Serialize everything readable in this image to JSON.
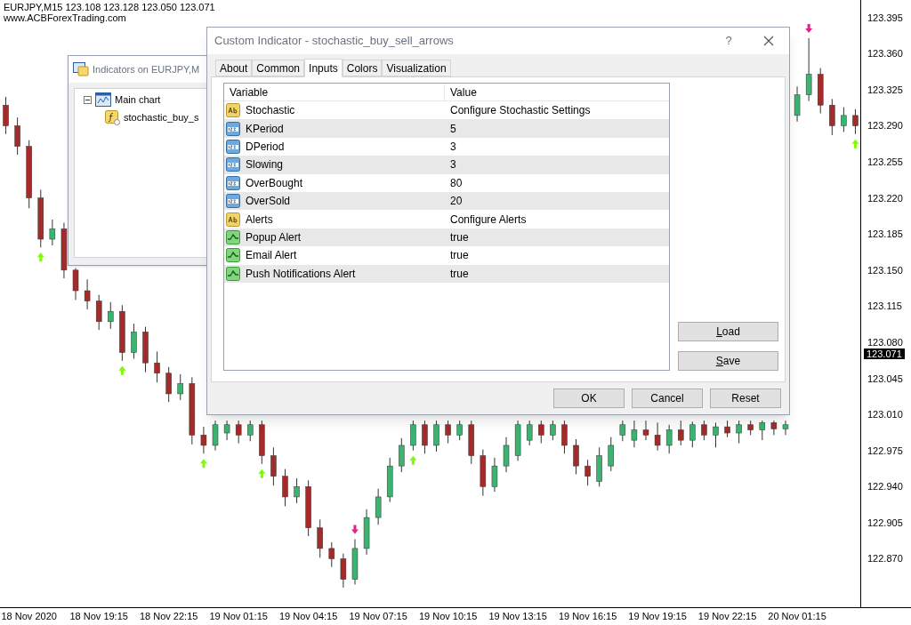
{
  "chart": {
    "symbol_info": "EURJPY,M15  123.108 123.128 123.050 123.071",
    "site": "www.ACBForexTrading.com",
    "current_price": "123.071",
    "chart_data": {
      "type": "candlestick",
      "categories": [
        null,
        null,
        "18 Nov 2020",
        null,
        null,
        null,
        null,
        null,
        "18 Nov 19:15",
        null,
        null,
        null,
        null,
        null,
        "18 Nov 22:15",
        null,
        null,
        null,
        null,
        null,
        "19 Nov 01:15",
        null,
        null,
        null,
        null,
        null,
        "19 Nov 04:15",
        null,
        null,
        null,
        null,
        null,
        "19 Nov 07:15",
        null,
        null,
        null,
        null,
        null,
        "19 Nov 10:15",
        null,
        null,
        null,
        null,
        null,
        "19 Nov 13:15",
        null,
        null,
        null,
        null,
        null,
        "19 Nov 16:15",
        null,
        null,
        null,
        null,
        null,
        "19 Nov 19:15",
        null,
        null,
        null,
        null,
        null,
        "19 Nov 22:15",
        null,
        null,
        null,
        null,
        null,
        "20 Nov 01:15",
        null,
        null,
        null,
        null,
        null
      ],
      "ohlc": [
        [
          123.31,
          123.318,
          123.282,
          123.29
        ],
        [
          123.29,
          123.298,
          123.262,
          123.27
        ],
        [
          123.27,
          123.276,
          123.21,
          123.22
        ],
        [
          123.22,
          123.228,
          123.172,
          123.18
        ],
        [
          123.18,
          123.199,
          123.174,
          123.19
        ],
        [
          123.19,
          123.196,
          123.142,
          123.15
        ],
        [
          123.15,
          123.152,
          123.121,
          123.13
        ],
        [
          123.13,
          123.141,
          123.112,
          123.12
        ],
        [
          123.12,
          123.126,
          123.092,
          123.1
        ],
        [
          123.1,
          123.119,
          123.093,
          123.11
        ],
        [
          123.11,
          123.116,
          123.062,
          123.07
        ],
        [
          123.07,
          123.098,
          123.064,
          123.09
        ],
        [
          123.09,
          123.095,
          123.051,
          123.06
        ],
        [
          123.06,
          123.071,
          123.041,
          123.05
        ],
        [
          123.05,
          123.056,
          123.022,
          123.03
        ],
        [
          123.03,
          123.049,
          123.024,
          123.04
        ],
        [
          123.04,
          123.046,
          122.981,
          122.99
        ],
        [
          122.99,
          122.998,
          122.972,
          122.98
        ],
        [
          122.98,
          123.004,
          122.975,
          123.0
        ],
        [
          122.992,
          123.004,
          122.985,
          123.0
        ],
        [
          123.0,
          123.004,
          122.982,
          122.99
        ],
        [
          122.99,
          123.004,
          122.984,
          123.0
        ],
        [
          123.0,
          123.004,
          122.962,
          122.97
        ],
        [
          122.97,
          122.978,
          122.941,
          122.95
        ],
        [
          122.95,
          122.957,
          122.921,
          122.93
        ],
        [
          122.93,
          122.948,
          122.924,
          122.94
        ],
        [
          122.94,
          122.946,
          122.892,
          122.9
        ],
        [
          122.9,
          122.908,
          122.871,
          122.88
        ],
        [
          122.88,
          122.886,
          122.862,
          122.87
        ],
        [
          122.87,
          122.875,
          122.842,
          122.85
        ],
        [
          122.85,
          122.889,
          122.845,
          122.88
        ],
        [
          122.88,
          122.918,
          122.874,
          122.91
        ],
        [
          122.91,
          122.938,
          122.903,
          122.93
        ],
        [
          122.93,
          122.968,
          122.925,
          122.96
        ],
        [
          122.96,
          122.987,
          122.954,
          122.98
        ],
        [
          122.98,
          123.004,
          122.975,
          123.0
        ],
        [
          123.0,
          123.004,
          122.972,
          122.98
        ],
        [
          122.98,
          123.004,
          122.974,
          123.0
        ],
        [
          123.0,
          123.004,
          122.982,
          122.99
        ],
        [
          122.99,
          123.004,
          122.985,
          123.0
        ],
        [
          123.0,
          123.004,
          122.962,
          122.97
        ],
        [
          122.97,
          122.976,
          122.931,
          122.94
        ],
        [
          122.94,
          122.968,
          122.935,
          122.96
        ],
        [
          122.96,
          122.988,
          122.954,
          122.98
        ],
        [
          122.97,
          123.004,
          122.965,
          123.0
        ],
        [
          122.985,
          123.004,
          122.98,
          123.0
        ],
        [
          123.0,
          123.004,
          122.982,
          122.99
        ],
        [
          122.99,
          123.004,
          122.985,
          123.0
        ],
        [
          123.0,
          123.004,
          122.972,
          122.98
        ],
        [
          122.98,
          122.986,
          122.952,
          122.96
        ],
        [
          122.96,
          122.966,
          122.941,
          122.95
        ],
        [
          122.945,
          122.978,
          122.94,
          122.97
        ],
        [
          122.96,
          122.988,
          122.955,
          122.98
        ],
        [
          122.99,
          123.004,
          122.984,
          123.0
        ],
        [
          122.985,
          123.004,
          122.978,
          122.995
        ],
        [
          122.995,
          123.004,
          122.985,
          122.99
        ],
        [
          122.99,
          123.002,
          122.975,
          122.98
        ],
        [
          122.98,
          123.0,
          122.972,
          122.995
        ],
        [
          122.995,
          123.004,
          122.98,
          122.985
        ],
        [
          122.985,
          123.003,
          122.978,
          123.0
        ],
        [
          123.0,
          123.004,
          122.985,
          122.99
        ],
        [
          122.99,
          123.002,
          122.978,
          122.998
        ],
        [
          122.998,
          123.004,
          122.988,
          122.992
        ],
        [
          122.992,
          123.004,
          122.982,
          123.0
        ],
        [
          123.0,
          123.004,
          122.99,
          122.995
        ],
        [
          122.995,
          123.004,
          122.985,
          123.002
        ],
        [
          123.002,
          123.004,
          122.99,
          122.996
        ],
        [
          122.996,
          123.004,
          122.99,
          123.0
        ],
        [
          123.3,
          123.328,
          123.294,
          123.32
        ],
        [
          123.32,
          123.375,
          123.314,
          123.34
        ],
        [
          123.34,
          123.346,
          123.302,
          123.31
        ],
        [
          123.31,
          123.316,
          123.281,
          123.29
        ],
        [
          123.29,
          123.308,
          123.284,
          123.3
        ],
        [
          123.3,
          123.306,
          123.282,
          123.29
        ]
      ],
      "ylim": [
        122.823,
        123.412
      ],
      "yticks": [
        {
          "value": 123.395,
          "label": "123.395"
        },
        {
          "value": 123.36,
          "label": "123.360"
        },
        {
          "value": 123.325,
          "label": "123.325"
        },
        {
          "value": 123.29,
          "label": "123.290"
        },
        {
          "value": 123.255,
          "label": "123.255"
        },
        {
          "value": 123.22,
          "label": "123.220"
        },
        {
          "value": 123.185,
          "label": "123.185"
        },
        {
          "value": 123.15,
          "label": "123.150"
        },
        {
          "value": 123.115,
          "label": "123.115"
        },
        {
          "value": 123.08,
          "label": "123.080"
        },
        {
          "value": 123.045,
          "label": "123.045"
        },
        {
          "value": 123.01,
          "label": "123.010"
        },
        {
          "value": 122.975,
          "label": "122.975"
        },
        {
          "value": 122.94,
          "label": "122.940"
        },
        {
          "value": 122.905,
          "label": "122.905"
        },
        {
          "value": 122.87,
          "label": "122.870"
        }
      ]
    }
  },
  "indicators_window": {
    "title": "Indicators on EURJPY,M",
    "tree": [
      {
        "label": "Main chart",
        "expanded": true,
        "children": [
          {
            "label": "stochastic_buy_s"
          }
        ]
      }
    ]
  },
  "dialog": {
    "title": "Custom Indicator - stochastic_buy_sell_arrows",
    "help": "?",
    "tabs": [
      {
        "label": "About",
        "selected": false
      },
      {
        "label": "Common",
        "selected": false
      },
      {
        "label": "Inputs",
        "selected": true
      },
      {
        "label": "Colors",
        "selected": false
      },
      {
        "label": "Visualization",
        "selected": false
      }
    ],
    "columns": [
      "Variable",
      "Value"
    ],
    "rows": [
      {
        "kind": "text",
        "variable": "Stochastic",
        "value": "Configure Stochastic Settings"
      },
      {
        "kind": "number",
        "variable": "KPeriod",
        "value": "5"
      },
      {
        "kind": "number",
        "variable": "DPeriod",
        "value": "3"
      },
      {
        "kind": "number",
        "variable": "Slowing",
        "value": "3"
      },
      {
        "kind": "number",
        "variable": "OverBought",
        "value": "80"
      },
      {
        "kind": "number",
        "variable": "OverSold",
        "value": "20"
      },
      {
        "kind": "text",
        "variable": "Alerts",
        "value": "Configure Alerts"
      },
      {
        "kind": "bool",
        "variable": "Popup Alert",
        "value": "true"
      },
      {
        "kind": "bool",
        "variable": "Email Alert",
        "value": "true"
      },
      {
        "kind": "bool",
        "variable": "Push Notifications Alert",
        "value": "true"
      }
    ],
    "side_buttons": [
      "Load",
      "Save"
    ],
    "buttons": [
      "OK",
      "Cancel",
      "Reset"
    ]
  }
}
